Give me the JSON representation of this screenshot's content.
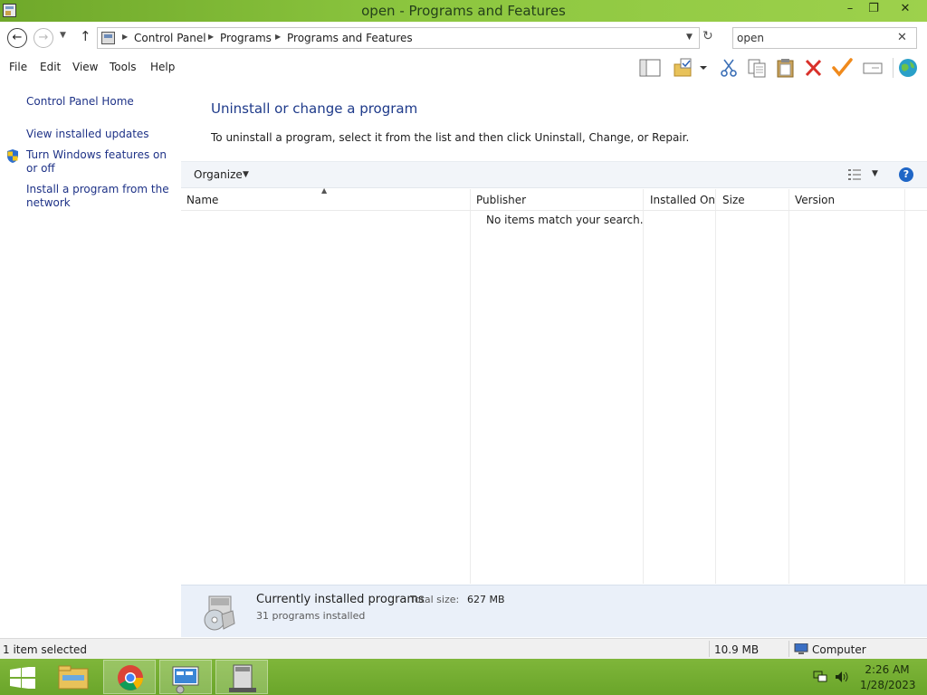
{
  "window": {
    "title": "open - Programs and Features",
    "controls": {
      "minimize": "–",
      "maximize": "❐",
      "close": "✕"
    }
  },
  "address_bar": {
    "breadcrumbs": [
      "Control Panel",
      "Programs",
      "Programs and Features"
    ],
    "search_value": "open"
  },
  "menu": {
    "items": [
      "File",
      "Edit",
      "View",
      "Tools",
      "Help"
    ]
  },
  "toolbar": {
    "icons": [
      "layout-pane-icon",
      "folder-options-icon",
      "cut-icon",
      "copy-icon",
      "paste-icon",
      "delete-icon",
      "properties-check-icon",
      "rename-icon",
      "globe-icon"
    ]
  },
  "left_pane": {
    "tasks": [
      "Control Panel Home",
      "View installed updates",
      "Turn Windows features on or off",
      "Install a program from the network"
    ]
  },
  "main": {
    "heading": "Uninstall or change a program",
    "instructions": "To uninstall a program, select it from the list and then click Uninstall, Change, or Repair.",
    "organize_label": "Organize",
    "columns": [
      "Name",
      "Publisher",
      "Installed On",
      "Size",
      "Version"
    ],
    "empty_message": "No items match your search."
  },
  "details": {
    "title": "Currently installed programs",
    "total_size_label": "Total size:",
    "total_size_value": "627 MB",
    "count": "31 programs installed"
  },
  "status_bar": {
    "selection": "1 item selected",
    "size": "10.9 MB",
    "zone": "Computer"
  },
  "taskbar": {
    "apps": [
      "file-explorer-icon",
      "chrome-icon",
      "control-panel-icon",
      "programs-window-icon"
    ],
    "time": "2:26 AM",
    "date": "1/28/2023"
  },
  "colors": {
    "titlebar_green": "#8cc63f",
    "taskbar_green": "#6aa52a",
    "link_blue": "#1e3287",
    "heading_blue": "#1e3a8a"
  }
}
